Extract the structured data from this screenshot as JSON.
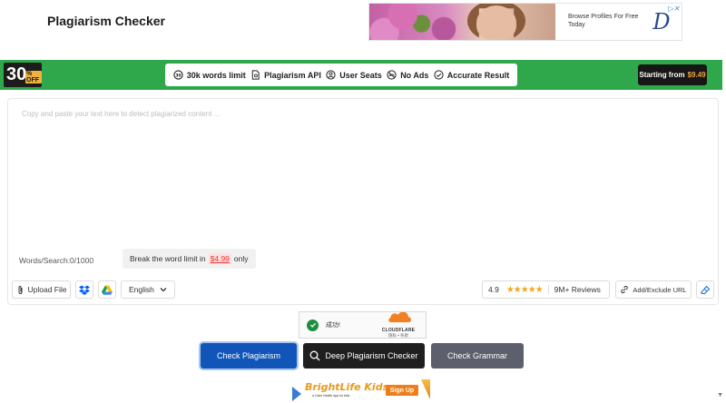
{
  "header": {
    "title": "Plagiarism Checker"
  },
  "top_ad": {
    "text": "Browse Profiles For Free Today",
    "logo_letter": "D"
  },
  "promo": {
    "badge_number": "30",
    "badge_text": "% OFF",
    "features": [
      {
        "label": "30k words limit",
        "icon": "no-limit-icon"
      },
      {
        "label": "Plagiarism API",
        "icon": "document-icon"
      },
      {
        "label": "User Seats",
        "icon": "user-icon"
      },
      {
        "label": "No Ads",
        "icon": "no-ads-icon"
      },
      {
        "label": "Accurate Result",
        "icon": "check-circle-icon"
      }
    ],
    "cta_label": "Starting from",
    "cta_price": "$9.49",
    "color": "#2ea84a"
  },
  "editor": {
    "placeholder": "Copy and paste your text here to detect plagiarized content ...",
    "word_count": "Words/Search:0/1000",
    "break_text": "Break the word limit in",
    "break_price": "$4.99",
    "break_suffix": "only"
  },
  "toolbar": {
    "upload_label": "Upload File",
    "language": "English",
    "rating": "4.9",
    "reviews": "9M+ Reviews",
    "url_label": "Add/Exclude URL"
  },
  "captcha": {
    "status": "成功!",
    "brand": "CLOUDFLARE",
    "links": "隐私 • 条款"
  },
  "actions": {
    "check": "Check Plagiarism",
    "deep": "Deep Plagiarism Checker",
    "grammar": "Check Grammar"
  },
  "bottom_ad": {
    "brand": "BrightLife Kids",
    "tagline": "a Calm Health app for kids",
    "signup": "Sign Up"
  }
}
